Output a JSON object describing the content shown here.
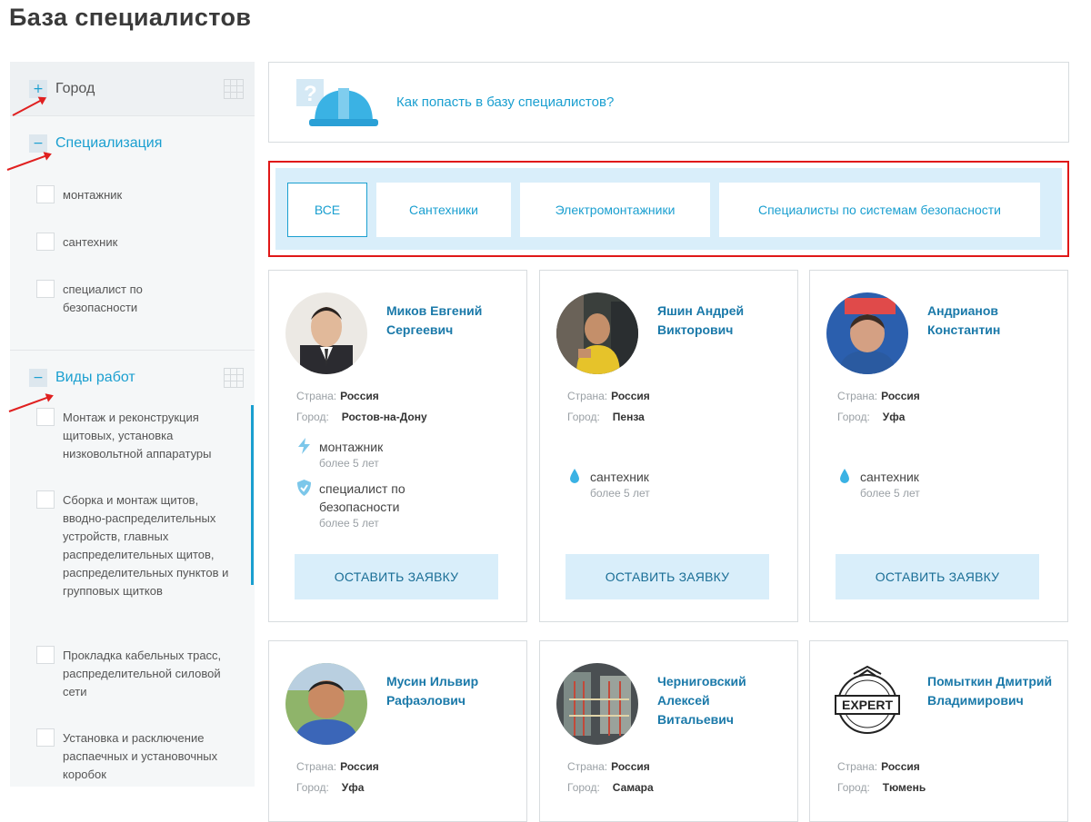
{
  "page": {
    "title": "База специалистов"
  },
  "sidebar": {
    "city": {
      "toggle": "+",
      "title": "Город"
    },
    "specialization": {
      "toggle": "−",
      "title": "Специализация",
      "items": [
        "монтажник",
        "сантехник",
        "специалист по безопасности"
      ]
    },
    "work_types": {
      "toggle": "−",
      "title": "Виды работ",
      "items": [
        "Монтаж и реконструкция щитовых, установка низковольтной аппаратуры",
        "Сборка и монтаж щитов, вводно-распределительных устройств, главных распределительных щитов, распределительных пунктов и групповых щитков",
        "Прокладка кабельных трасс, распределительной силовой сети",
        "Установка и расключение распаечных и установочных коробок"
      ]
    }
  },
  "info": {
    "link": "Как попасть в базу специалистов?"
  },
  "filters": {
    "tabs": [
      "ВСЕ",
      "Сантехники",
      "Электромонтажники",
      "Специалисты по системам безопасности"
    ],
    "active": 0
  },
  "labels": {
    "country": "Страна:",
    "city": "Город:",
    "order_button": "ОСТАВИТЬ ЗАЯВКУ"
  },
  "colors": {
    "accent": "#1a9fd0",
    "button_bg": "#d9eefa",
    "highlight": "#e01818"
  },
  "specialists": [
    {
      "name": "Миков Евгений Сергеевич",
      "country": "Россия",
      "city": "Ростов-на-Дону",
      "specs": [
        {
          "icon": "lightning-icon",
          "name": "монтажник",
          "exp": "более 5 лет"
        },
        {
          "icon": "shield-icon",
          "name": "специалист по безопасности",
          "exp": "более 5 лет"
        }
      ]
    },
    {
      "name": "Яшин Андрей Викторович",
      "country": "Россия",
      "city": "Пенза",
      "specs": [
        {
          "icon": "water-drop-icon",
          "name": "сантехник",
          "exp": "более 5 лет"
        }
      ]
    },
    {
      "name": "Андрианов Константин",
      "country": "Россия",
      "city": "Уфа",
      "specs": [
        {
          "icon": "water-drop-icon",
          "name": "сантехник",
          "exp": "более 5 лет"
        }
      ]
    },
    {
      "name": "Мусин Ильвир Рафаэлович",
      "country": "Россия",
      "city": "Уфа"
    },
    {
      "name": "Черниговский Алексей Витальевич",
      "country": "Россия",
      "city": "Самара"
    },
    {
      "name": "Помыткин Дмитрий Владимирович",
      "country": "Россия",
      "city": "Тюмень",
      "logo_text": "EXPERT"
    }
  ]
}
